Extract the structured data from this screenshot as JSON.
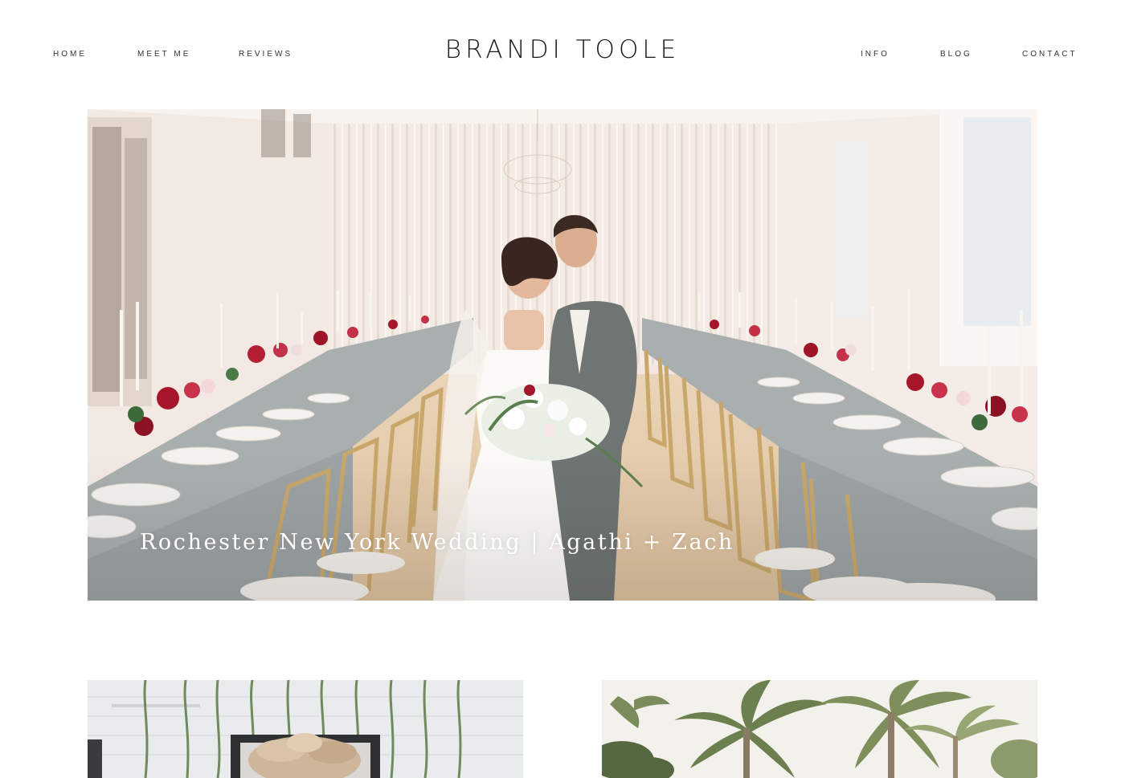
{
  "header": {
    "logo": "BRANDI TOOLE",
    "nav_left": [
      {
        "label": "HOME"
      },
      {
        "label": "MEET ME"
      },
      {
        "label": "REVIEWS"
      }
    ],
    "nav_right": [
      {
        "label": "INFO"
      },
      {
        "label": "BLOG"
      },
      {
        "label": "CONTACT"
      }
    ]
  },
  "featured_post": {
    "title": "Rochester New York Wedding | Agathi + Zach",
    "image": "wedding-reception-couple-photo"
  },
  "posts": [
    {
      "image": "greenery-wall-pampas-arrangement-photo"
    },
    {
      "image": "palm-trees-photo"
    }
  ],
  "colors": {
    "background": "#ffffff",
    "text": "#222222",
    "hero_title": "#ffffff"
  }
}
